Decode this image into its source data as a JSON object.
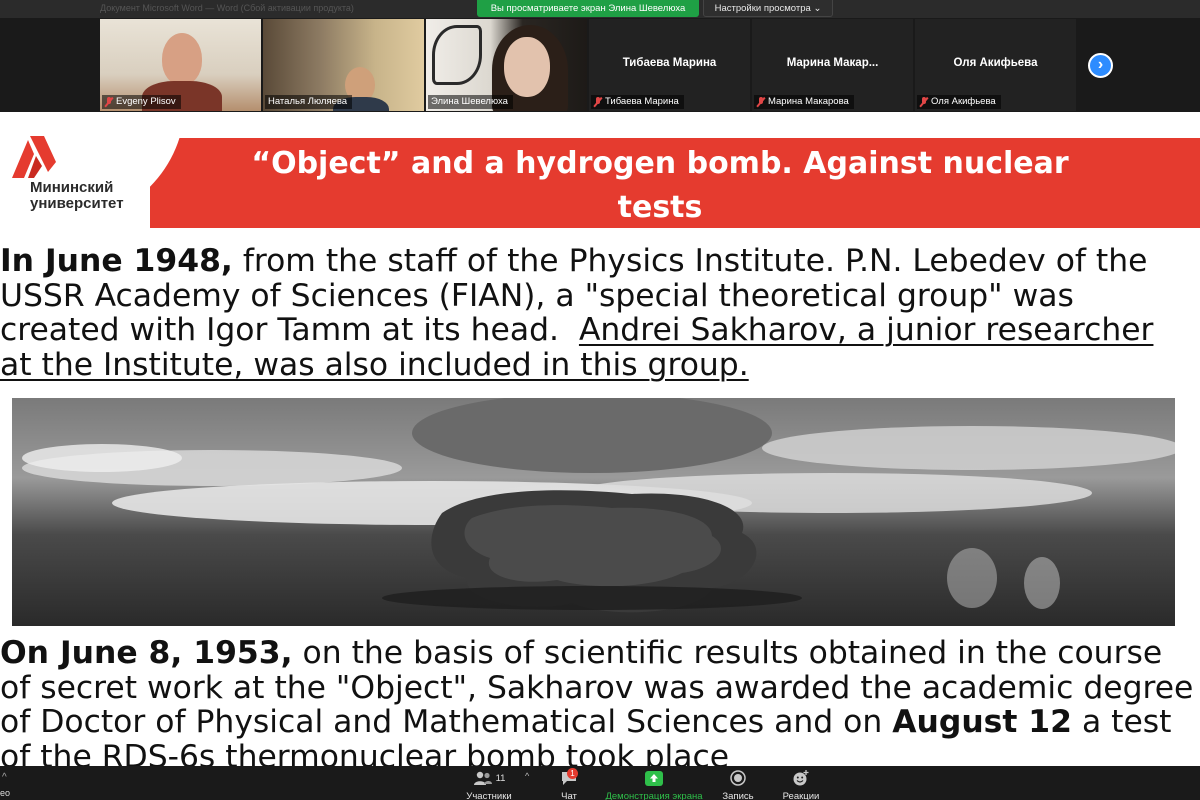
{
  "share_bar": {
    "ghost_text": "Документ Microsoft Word — Word (Сбой активации продукта)",
    "sharing_text": "Вы просматриваете экран Элина Шевелюха",
    "view_settings": "Настройки просмотра ⌄"
  },
  "participants": [
    {
      "name": "Evgeny Plisov",
      "video": true,
      "muted": true
    },
    {
      "name": "Наталья Люляева",
      "video": true,
      "muted": false
    },
    {
      "name": "Элина Шевелюха",
      "video": true,
      "muted": false,
      "active_speaker": true
    },
    {
      "name": "Тибаева Марина",
      "tile_name": "Тибаева Марина",
      "video": false,
      "muted": true
    },
    {
      "name": "Марина Макарова",
      "tile_name": "Марина  Макар...",
      "video": false,
      "muted": true
    },
    {
      "name": "Оля Акифьева",
      "tile_name": "Оля Акифьева",
      "video": false,
      "muted": true
    }
  ],
  "slide": {
    "logo_line1": "Мининский",
    "logo_line2": "университет",
    "title_line1": "“Object” and a hydrogen bomb. Against nuclear",
    "title_line2": "tests",
    "p1_bold": "In June 1948,",
    "p1_l1_rest": " from the staff of the Physics Institute. P.N. Lebedev of the",
    "p1_l2": "USSR Academy of Sciences (FIAN), a \"special theoretical group\" was",
    "p1_l3_plain": "created with Igor Tamm at its head.  ",
    "p1_l3_under": "Andrei Sakharov, a junior researcher",
    "p1_l4_under": "at the Institute, was also included in this group.",
    "p2_bold": "On June 8, 1953,",
    "p2_l1_rest": " on the basis of scientific results obtained in the course",
    "p2_l2": "of secret work at the \"Object\", Sakharov was awarded the academic degree",
    "p2_l3_plain": "of Doctor of Physical and Mathematical Sciences and on ",
    "p2_l3_bold": "August 12",
    "p2_l3_end": " a test",
    "p2_l4": "of the RDS-6s thermonuclear bomb took place"
  },
  "toolbar": {
    "left_label": "ео",
    "participants_label": "Участники",
    "participants_count": "11",
    "chat_label": "Чат",
    "chat_badge": "1",
    "share_label": "Демонстрация экрана",
    "record_label": "Запись",
    "reactions_label": "Реакции"
  },
  "colors": {
    "accent_red": "#e53b2f",
    "share_green": "#1fa045",
    "next_blue": "#2d8cff"
  }
}
